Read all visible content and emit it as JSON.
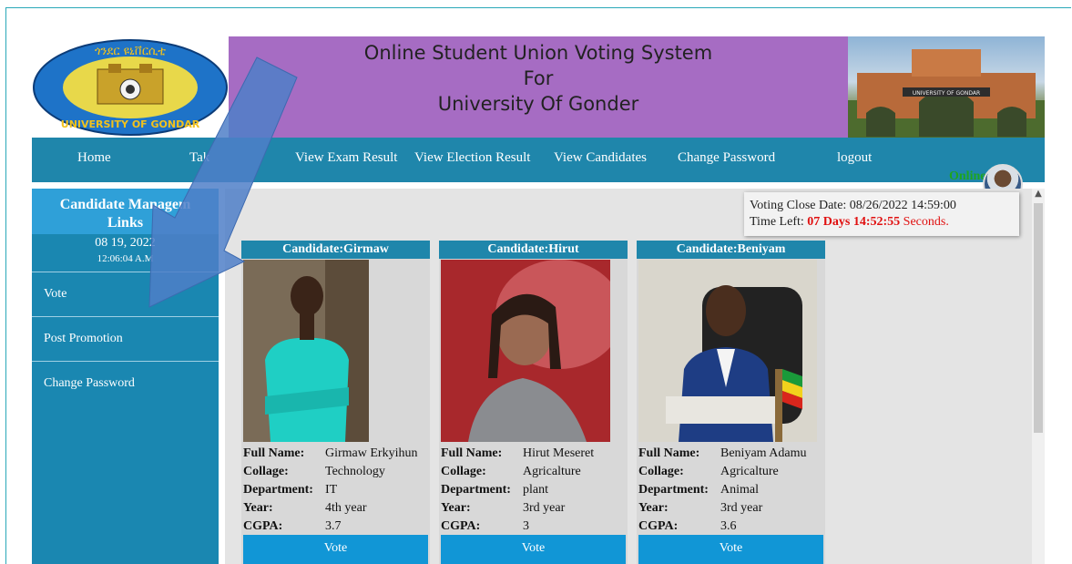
{
  "header": {
    "logo_text_top": "ጎንደር ዩኒቨርሲቲ",
    "logo_text_bottom": "UNIVERSITY OF GONDAR",
    "title_line1": "Online Student Union Voting System",
    "title_line2": "For",
    "title_line3": "University Of Gonder",
    "gate_sign": "UNIVERSITY OF GONDAR"
  },
  "nav": {
    "items": [
      "Home",
      "Tak",
      "View Exam Result",
      "View Election Result",
      "View Candidates",
      "Change Password",
      "logout"
    ]
  },
  "sidebar": {
    "heading_line1": "Candidate Managem",
    "heading_line2": "Links",
    "date": "08 19, 2022",
    "time": "12:06:04 A.M",
    "items": [
      "Vote",
      "Post Promotion",
      "Change Password"
    ]
  },
  "status": {
    "online": "Online",
    "close_label": "Voting Close Date: 08/26/2022 14:59:00",
    "time_left_label": "Time Left:",
    "days": "07 Days",
    "clock": "14:52:55",
    "seconds": "Seconds."
  },
  "candidates": [
    {
      "heading": "Candidate:Girmaw",
      "full_name": "Girmaw Erkyihun",
      "collage": "Technology",
      "department": "IT",
      "year": "4th year",
      "cgpa": "3.7",
      "vote": "Vote"
    },
    {
      "heading": "Candidate:Hirut",
      "full_name": "Hirut Meseret",
      "collage": "Agricalture",
      "department": "plant",
      "year": "3rd year",
      "cgpa": "3",
      "vote": "Vote"
    },
    {
      "heading": "Candidate:Beniyam",
      "full_name": "Beniyam Adamu",
      "collage": "Agricalture",
      "department": "Animal",
      "year": "3rd year",
      "cgpa": "3.6",
      "vote": "Vote"
    }
  ],
  "labels": {
    "full_name": "Full Name:",
    "collage": "Collage:",
    "department": "Department:",
    "year": "Year:",
    "cgpa": "CGPA:"
  },
  "colors": {
    "nav": "#1f86ab",
    "title_bg": "#a66cc3",
    "vote_button": "#1196d6",
    "online": "#1ea51e"
  }
}
